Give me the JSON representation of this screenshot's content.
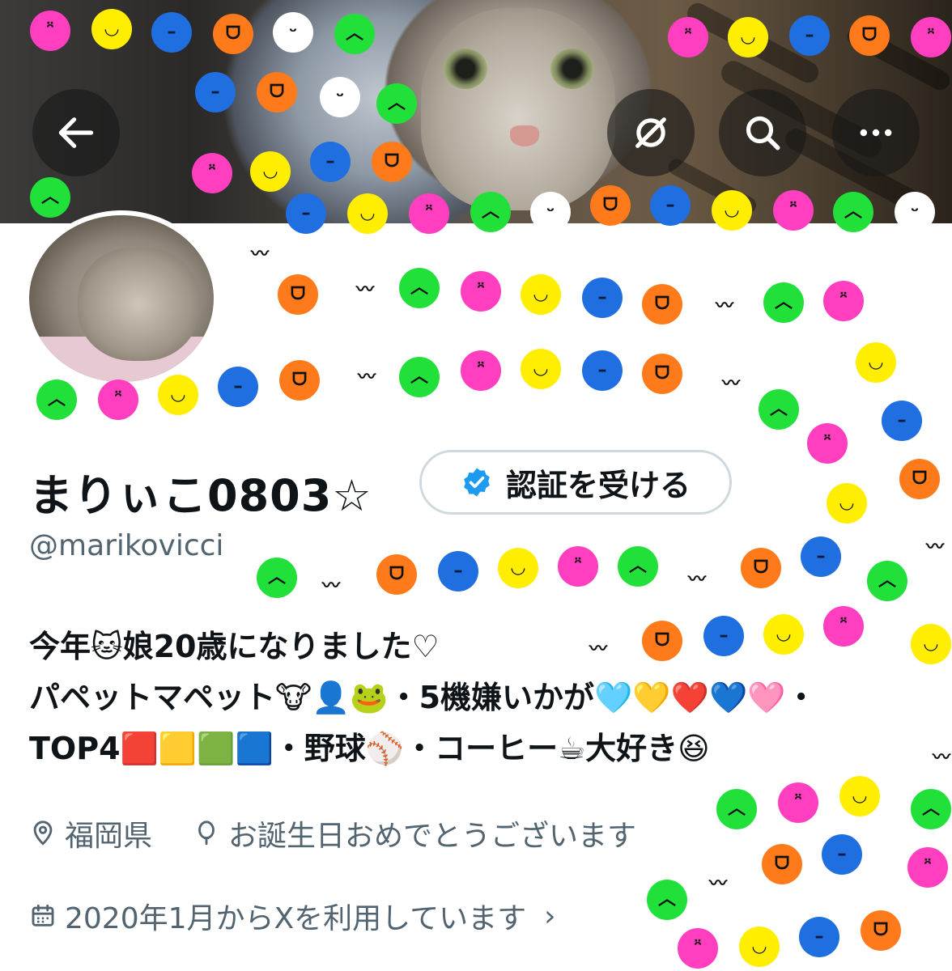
{
  "header": {
    "back_icon": "arrow-left-icon",
    "actions": [
      {
        "icon": "no-signal-icon"
      },
      {
        "icon": "search-icon"
      },
      {
        "icon": "more-horizontal-icon"
      }
    ]
  },
  "profile": {
    "display_name": "まりぃこ0803☆",
    "verify_button_label": "認証を受ける",
    "verify_icon": "verified-badge-icon",
    "handle": "@marikovicci",
    "bio_lines": [
      "今年🐱娘20歳になりました♡",
      "パペットマペット🐮👤🐸・5機嫌いかが🩵💛❤️💙🩷・",
      "TOP4🟥🟨🟩🟦・野球⚾・コーヒー☕大好き😆"
    ],
    "location": "福岡県",
    "birthday": "お誕生日おめでとうございます",
    "joined": "2020年1月からXを利用しています",
    "location_icon": "map-pin-icon",
    "birthday_icon": "balloon-icon",
    "joined_icon": "calendar-icon"
  },
  "colors": {
    "text_primary": "#0f1419",
    "text_secondary": "#536471",
    "verified_blue": "#1d9bf0",
    "button_border": "#cfd9de",
    "sticker_pink": "#ff3fbf",
    "sticker_yellow": "#ffee00",
    "sticker_blue": "#1f6fe0",
    "sticker_orange": "#ff7a1a",
    "sticker_green": "#22e03a"
  }
}
